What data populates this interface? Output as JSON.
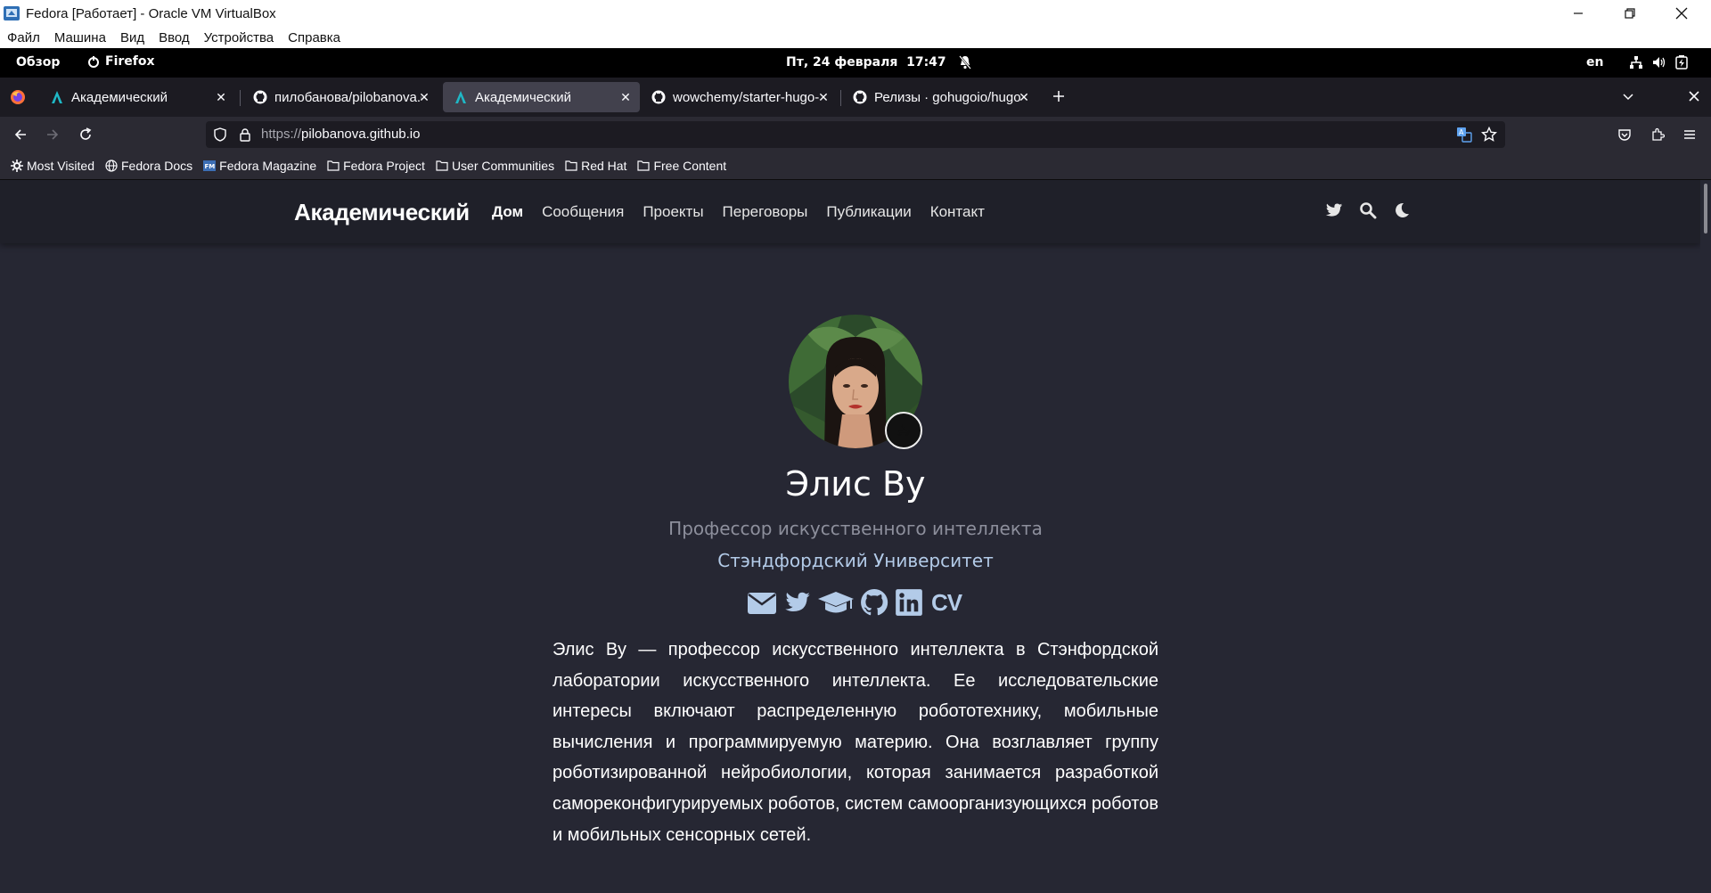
{
  "vbox": {
    "title": "Fedora [Работает] - Oracle VM VirtualBox",
    "menu": [
      "Файл",
      "Машина",
      "Вид",
      "Ввод",
      "Устройства",
      "Справка"
    ]
  },
  "gnome": {
    "overview": "Обзор",
    "app": "Firefox",
    "clock": "Пт, 24 февраля  17:47",
    "lang": "en"
  },
  "browser": {
    "tabs": [
      {
        "label": "Академический",
        "icon": "academic-logo-icon",
        "active": false
      },
      {
        "label": "пилобанова/pilobanova.gith",
        "icon": "github-icon",
        "active": false
      },
      {
        "label": "Академический",
        "icon": "academic-logo-icon",
        "active": true
      },
      {
        "label": "wowchemy/starter-hugo-ac",
        "icon": "github-icon",
        "active": false
      },
      {
        "label": "Релизы · gohugoio/hugo",
        "icon": "github-icon",
        "active": false
      }
    ],
    "url_protocol": "https://",
    "url_host": "pilobanova.github.io",
    "bookmarks": [
      "Most Visited",
      "Fedora Docs",
      "Fedora Magazine",
      "Fedora Project",
      "User Communities",
      "Red Hat",
      "Free Content"
    ]
  },
  "site": {
    "brand": "Академический",
    "menu": [
      "Дом",
      "Сообщения",
      "Проекты",
      "Переговоры",
      "Публикации",
      "Контакт"
    ],
    "author": {
      "name": "Элис Ву",
      "role": "Профессор искусственного интеллекта",
      "organization": "Стэндфордский Университет",
      "badge_emoji": "☕",
      "social": [
        "envelope-icon",
        "twitter-icon",
        "graduation-cap-icon",
        "github-icon",
        "linkedin-icon"
      ],
      "cv_label": "CV",
      "bio": "Элис Ву — профессор искусственного интеллекта в Стэнфордской лаборатории искусственного интеллекта. Ее исследовательские интересы включают распределенную робототехнику, мобильные вычисления и программируемую материю. Она возглавляет группу роботизированной нейробиологии, которая занимается разработкой самореконфигурируемых роботов, систем самоорганизующихся роботов и мобильных сенсорных сетей."
    }
  },
  "colors": {
    "page_bg": "#262733",
    "nav_bg": "#1f2029",
    "accent_link": "#b3cbe8",
    "muted_text": "#8d8f9c"
  }
}
